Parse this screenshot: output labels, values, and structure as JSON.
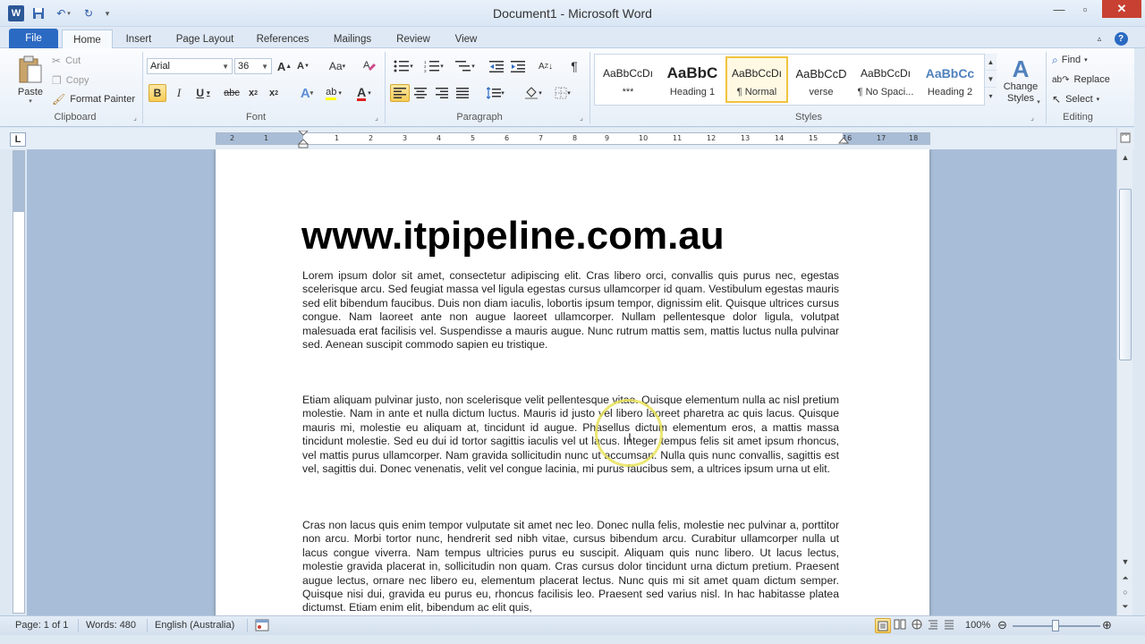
{
  "window": {
    "title": "Document1 - Microsoft Word",
    "app_icon": "W"
  },
  "quick_access": {
    "save_icon": "save-icon",
    "undo_icon": "undo-icon",
    "redo_icon": "redo-icon"
  },
  "tabs": [
    "File",
    "Home",
    "Insert",
    "Page Layout",
    "References",
    "Mailings",
    "Review",
    "View"
  ],
  "clipboard": {
    "paste": "Paste",
    "cut": "Cut",
    "copy": "Copy",
    "format_painter": "Format Painter",
    "group": "Clipboard"
  },
  "font": {
    "name": "Arial",
    "size": "36",
    "group": "Font"
  },
  "paragraph": {
    "group": "Paragraph"
  },
  "styles": {
    "items": [
      {
        "sample": "AaBbCcDı",
        "name": "***"
      },
      {
        "sample": "AaBbC",
        "name": "Heading 1"
      },
      {
        "sample": "AaBbCcDı",
        "name": "¶ Normal"
      },
      {
        "sample": "AaBbCcD",
        "name": "verse"
      },
      {
        "sample": "AaBbCcDı",
        "name": "¶ No Spaci..."
      },
      {
        "sample": "AaBbCc",
        "name": "Heading 2"
      }
    ],
    "change_styles": "Change Styles",
    "group": "Styles"
  },
  "editing": {
    "find": "Find",
    "replace": "Replace",
    "select": "Select",
    "group": "Editing"
  },
  "ruler": {
    "numbers": [
      "2",
      "1",
      "1",
      "2",
      "3",
      "4",
      "5",
      "6",
      "7",
      "8",
      "9",
      "10",
      "11",
      "12",
      "13",
      "14",
      "15",
      "16",
      "17",
      "18"
    ]
  },
  "document": {
    "heading": "www.itpipeline.com.au",
    "paragraphs": [
      "Lorem ipsum dolor sit amet, consectetur adipiscing elit. Cras libero orci, convallis quis purus nec, egestas scelerisque arcu. Sed feugiat massa vel ligula egestas cursus ullamcorper id quam. Vestibulum egestas mauris sed elit bibendum faucibus. Duis non diam iaculis, lobortis ipsum tempor, dignissim elit. Quisque ultrices cursus congue. Nam laoreet ante non augue laoreet ullamcorper. Nullam pellentesque dolor ligula, volutpat malesuada erat facilisis vel. Suspendisse a mauris augue. Nunc rutrum mattis sem, mattis luctus nulla pulvinar sed. Aenean suscipit commodo sapien eu tristique.",
      "Etiam aliquam pulvinar justo, non scelerisque velit pellentesque vitae. Quisque elementum nulla ac nisl pretium molestie. Nam in ante et nulla dictum luctus. Mauris id justo vel libero laoreet pharetra ac quis lacus. Quisque mauris mi, molestie eu aliquam at, tincidunt id augue. Phasellus dictum elementum eros, a mattis massa tincidunt molestie. Sed eu dui id tortor sagittis iaculis vel ut lacus. Integer tempus felis sit amet ipsum rhoncus, vel mattis purus ullamcorper. Nam gravida sollicitudin nunc ut accumsan. Nulla quis nunc convallis, sagittis est vel, sagittis dui. Donec venenatis, velit vel congue lacinia, mi purus faucibus sem, a ultrices ipsum urna ut elit.",
      "Cras non lacus quis enim tempor vulputate sit amet nec leo. Donec nulla felis, molestie nec pulvinar a, porttitor non arcu. Morbi tortor nunc, hendrerit sed nibh vitae, cursus bibendum arcu. Curabitur ullamcorper nulla ut lacus congue viverra. Nam tempus ultricies purus eu suscipit. Aliquam quis nunc libero. Ut lacus lectus, molestie gravida placerat in, sollicitudin non quam. Cras cursus dolor tincidunt urna dictum pretium. Praesent augue lectus, ornare nec libero eu, elementum placerat lectus. Nunc quis mi sit amet quam dictum semper. Quisque nisi dui, gravida eu purus eu, rhoncus facilisis leo. Praesent sed varius nisl. In hac habitasse platea dictumst. Etiam enim elit, bibendum ac elit quis,"
    ]
  },
  "status": {
    "page": "Page: 1 of 1",
    "words": "Words: 480",
    "language": "English (Australia)",
    "zoom": "100%"
  },
  "colors": {
    "file_tab": "#2b6ac2",
    "close_button": "#c84031",
    "selected_style": "#f1c43f",
    "highlight_circle": "#e9e35a"
  }
}
